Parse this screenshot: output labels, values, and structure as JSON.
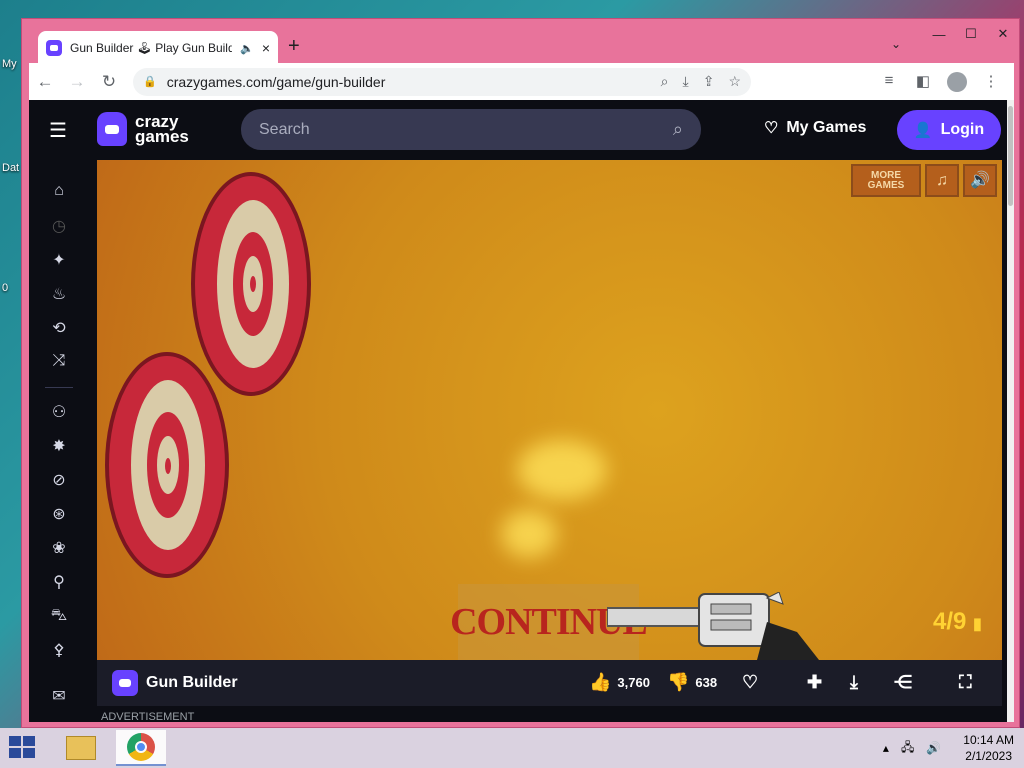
{
  "desktop": {
    "icons": [
      "My",
      "Dat",
      "0"
    ]
  },
  "browser": {
    "tab_title": "Gun Builder 🕹 Play Gun Builder",
    "tab_audio_icon": "speaker-icon",
    "tab_close": "×",
    "new_tab": "+",
    "url": "crazygames.com/game/gun-builder",
    "window_controls": {
      "minimize": "—",
      "maximize": "☐",
      "close": "✕"
    }
  },
  "site": {
    "logo_line1": "crazy",
    "logo_line2": "games",
    "search_placeholder": "Search",
    "my_games": "My Games",
    "login": "Login"
  },
  "game": {
    "title": "Gun Builder",
    "more_games_line1": "MORE",
    "more_games_line2": "GAMES",
    "ammo": "4/9",
    "continue": "CONTINUE",
    "likes": "3,760",
    "dislikes": "638"
  },
  "advertisement": "ADVERTISEMENT",
  "taskbar": {
    "time": "10:14 AM",
    "date": "2/1/2023"
  },
  "colors": {
    "accent": "#6842ff",
    "window_frame": "#e8739b",
    "game_bg": "#d39a1f"
  }
}
